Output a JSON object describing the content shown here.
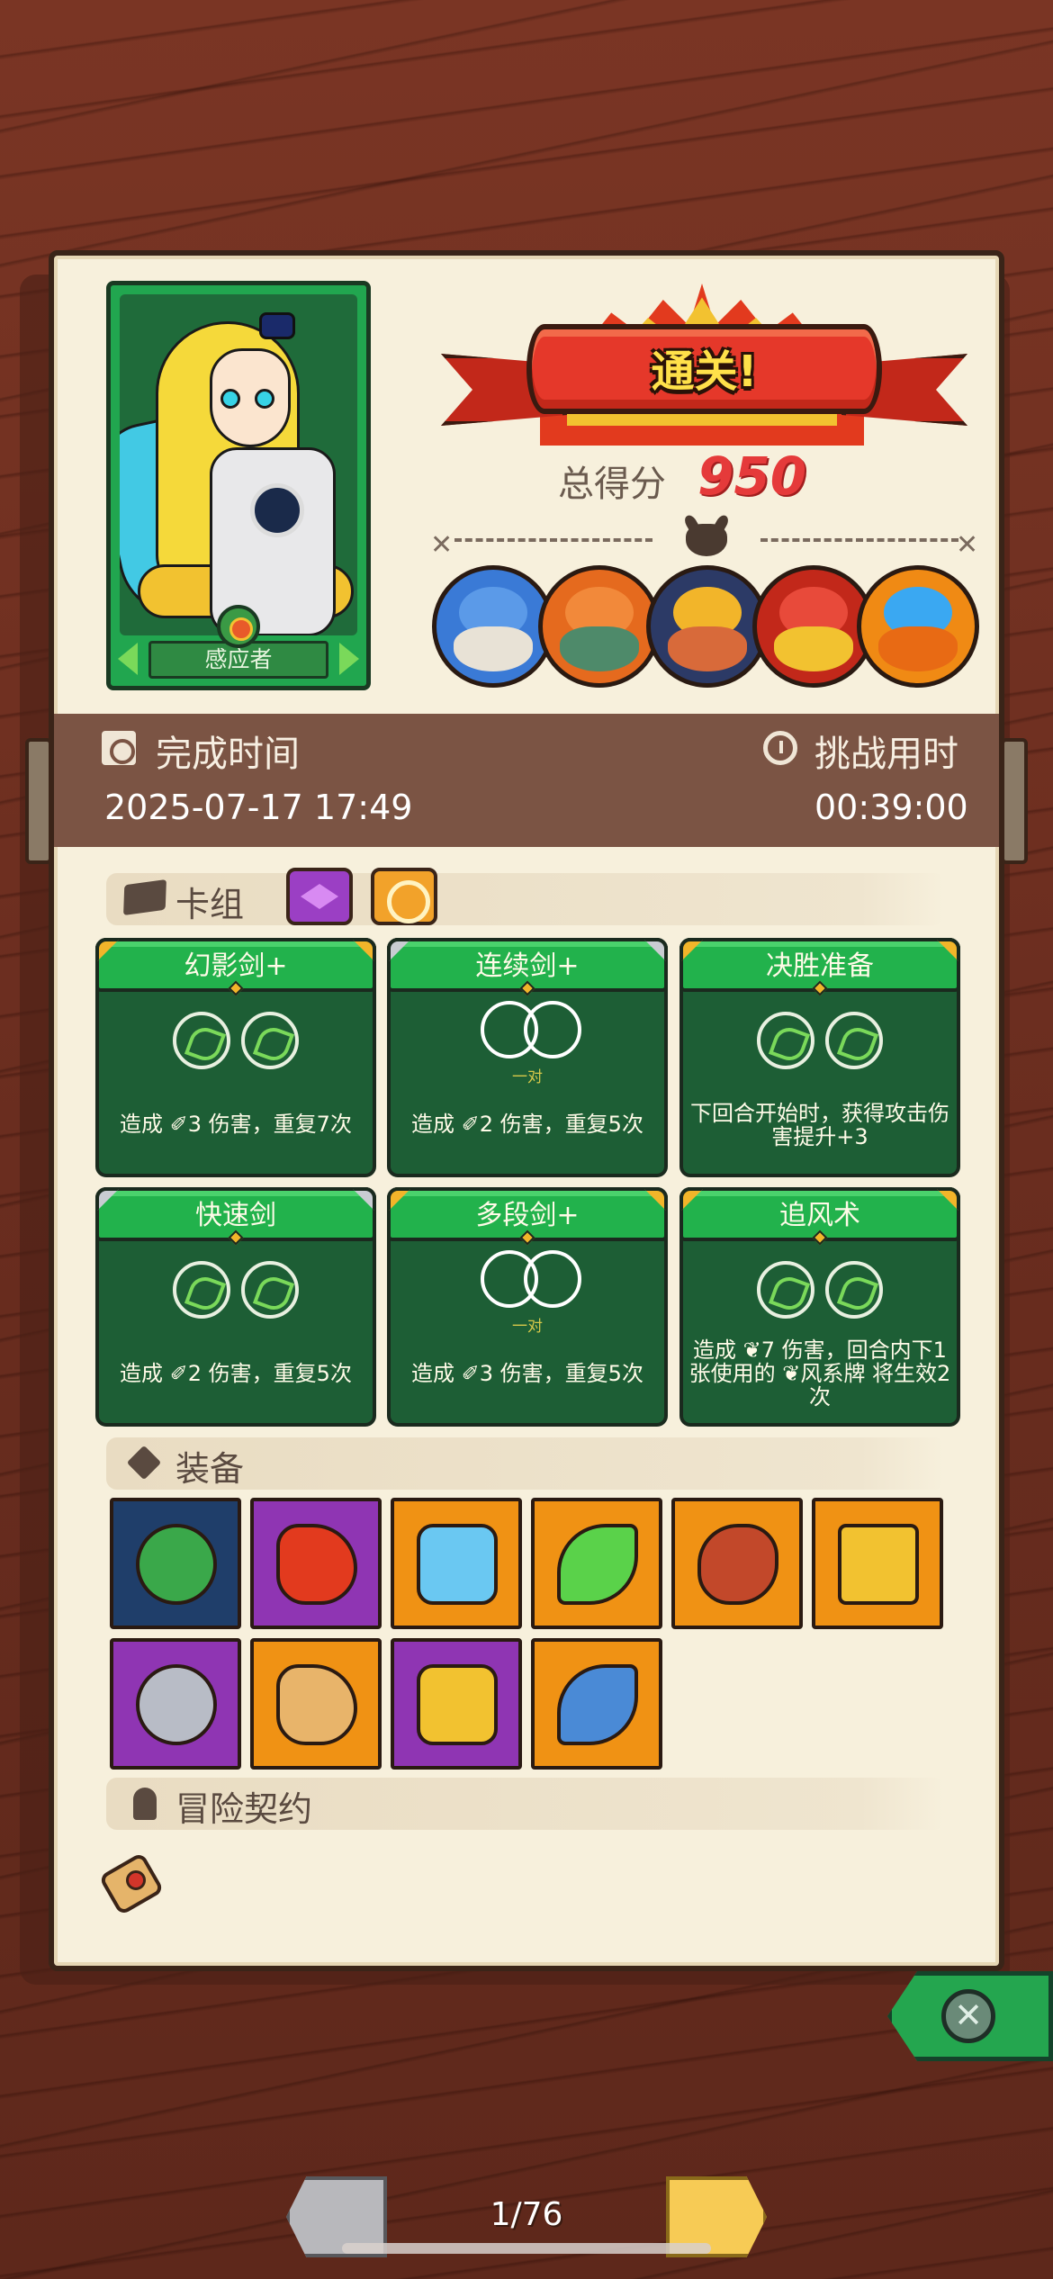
{
  "hero": {
    "class_label": "感应者"
  },
  "result": {
    "banner": "通关!",
    "score_label": "总得分",
    "score_value": "950"
  },
  "bosses": [
    {
      "name": "mushroom-elder-boss",
      "bg": "#3a7ad6",
      "c1": "#5b9ae8",
      "c2": "#e8e2d6"
    },
    {
      "name": "orange-ogre-boss",
      "bg": "#e56a1e",
      "c1": "#f2893a",
      "c2": "#4e8a6a"
    },
    {
      "name": "fish-king-boss",
      "bg": "#2c3a66",
      "c1": "#f2b52a",
      "c2": "#d86a3a"
    },
    {
      "name": "red-dragon-boss",
      "bg": "#c2281a",
      "c1": "#e84a3a",
      "c2": "#f2c230"
    },
    {
      "name": "crystal-golem-boss",
      "bg": "#f08a14",
      "c1": "#3aa8f2",
      "c2": "#e86a14"
    }
  ],
  "times": {
    "finish_label": "完成时间",
    "finish_value": "2025-07-17  17:49",
    "duration_label": "挑战用时",
    "duration_value": "00:39:00"
  },
  "deck": {
    "title": "卡组",
    "cards": [
      {
        "name": "幻影剑+",
        "desc": "造成 ✐3 伤害，重复7次",
        "type": "runes",
        "corner": "gold"
      },
      {
        "name": "连续剑+",
        "desc": "造成 ✐2 伤害，重复5次",
        "type": "pair",
        "pair_label": "一对",
        "corner": "silver"
      },
      {
        "name": "决胜准备",
        "desc": "下回合开始时，获得攻击伤害提升+3",
        "type": "runes",
        "corner": "gold"
      },
      {
        "name": "快速剑",
        "desc": "造成 ✐2 伤害，重复5次",
        "type": "runes",
        "corner": "silver"
      },
      {
        "name": "多段剑+",
        "desc": "造成 ✐3 伤害，重复5次",
        "type": "pair",
        "pair_label": "一对",
        "corner": "gold"
      },
      {
        "name": "追风术",
        "desc": "造成 ❦7 伤害，回合内下1张使用的 ❦风系牌 将生效2次",
        "type": "runes",
        "corner": "gold"
      }
    ]
  },
  "equipment": {
    "title": "装备",
    "items": [
      {
        "name": "emerald-hex-amulet",
        "rarity": "blue",
        "art": "#3aa84a"
      },
      {
        "name": "red-potion-flask",
        "rarity": "purple",
        "art": "#e23a1e"
      },
      {
        "name": "ice-skull-shield",
        "rarity": "orange",
        "art": "#6ac8f2"
      },
      {
        "name": "green-feather",
        "rarity": "orange",
        "art": "#5ad24a"
      },
      {
        "name": "roast-meat",
        "rarity": "orange",
        "art": "#c2482a"
      },
      {
        "name": "golden-cross-emblem",
        "rarity": "orange",
        "art": "#f2c230"
      },
      {
        "name": "steel-cube",
        "rarity": "purple",
        "art": "#b8bcc6"
      },
      {
        "name": "treasure-sack",
        "rarity": "orange",
        "art": "#e8b46a"
      },
      {
        "name": "golden-chest",
        "rarity": "purple",
        "art": "#f2c230"
      },
      {
        "name": "battle-axe",
        "rarity": "orange",
        "art": "#4a8ad6"
      }
    ]
  },
  "contract": {
    "title": "冒险契约",
    "items": [
      "scroll"
    ]
  },
  "pager": {
    "text": "1/76"
  }
}
